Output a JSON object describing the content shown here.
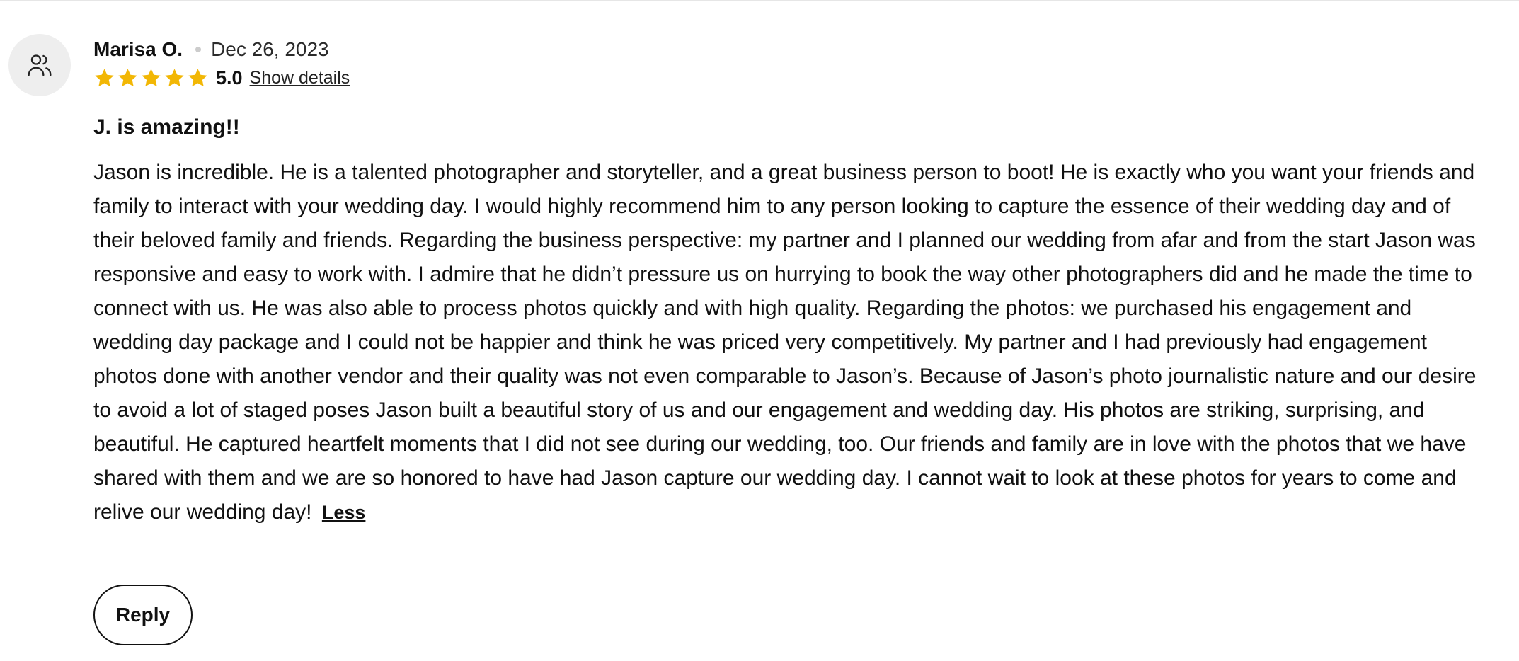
{
  "review": {
    "author": "Marisa O.",
    "date": "Dec 26, 2023",
    "rating": 5.0,
    "rating_label": "5.0",
    "show_details_label": "Show details",
    "title": "J. is amazing!!",
    "body": "Jason is incredible. He is a talented photographer and storyteller, and a great business person to boot! He is exactly who you want your friends and family to interact with your wedding day. I would highly recommend him to any person looking to capture the essence of their wedding day and of their beloved family and friends. Regarding the business perspective: my partner and I planned our wedding from afar and from the start Jason was responsive and easy to work with. I admire that he didn’t pressure us on hurrying to book the way other photographers did and he made the time to connect with us. He was also able to process photos quickly and with high quality. Regarding the photos: we purchased his engagement and wedding day package and I could not be happier and think he was priced very competitively. My partner and I had previously had engagement photos done with another vendor and their quality was not even comparable to Jason’s. Because of Jason’s photo journalistic nature and our desire to avoid a lot of staged poses Jason built a beautiful story of us and our engagement and wedding day. His photos are striking, surprising, and beautiful. He captured heartfelt moments that I did not see during our wedding, too. Our friends and family are in love with the photos that we have shared with them and we are so honored to have had Jason capture our wedding day. I cannot wait to look at these photos for years to come and relive our wedding day!",
    "less_label": "Less",
    "reply_label": "Reply",
    "avatar_icon": "users-icon",
    "star_icon": "star-icon"
  },
  "colors": {
    "star": "#F2B705",
    "avatar_bg": "#EEEEEE",
    "text": "#111111",
    "divider": "#E6E6E6"
  }
}
